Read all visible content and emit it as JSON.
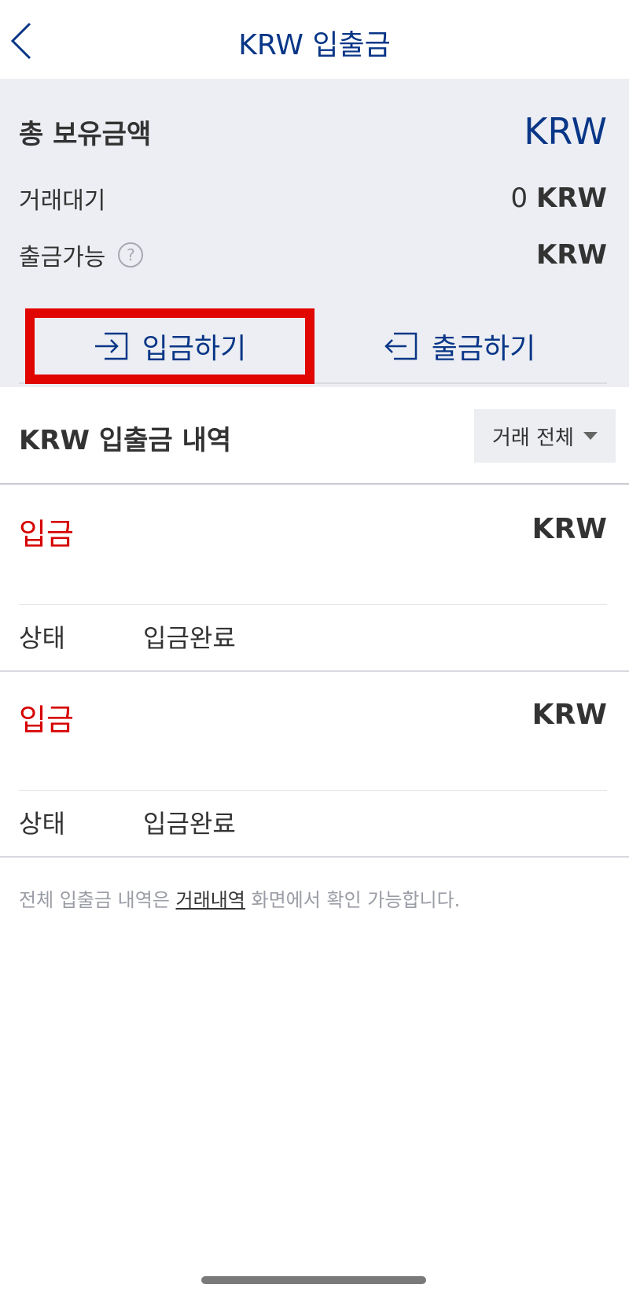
{
  "header": {
    "title": "KRW 입출금"
  },
  "summary": {
    "total_label": "총 보유금액",
    "total_value": "KRW",
    "pending_label": "거래대기",
    "pending_amount": "0",
    "pending_unit": "KRW",
    "withdrawable_label": "출금가능",
    "help_glyph": "?",
    "withdrawable_unit": "KRW"
  },
  "actions": {
    "deposit_label": "입금하기",
    "withdraw_label": "출금하기"
  },
  "history": {
    "title": "KRW 입출금 내역",
    "filter_label": "거래 전체",
    "items": [
      {
        "type": "입금",
        "amount": "KRW",
        "status_label": "상태",
        "status_value": "입금완료"
      },
      {
        "type": "입금",
        "amount": "KRW",
        "status_label": "상태",
        "status_value": "입금완료"
      }
    ]
  },
  "footnote": {
    "prefix": "전체 입출금 내역은",
    "link": "거래내역",
    "suffix": "화면에서 확인 가능합니다."
  },
  "colors": {
    "brand": "#093687",
    "deposit": "#d60000",
    "highlight_border": "#e10600"
  }
}
